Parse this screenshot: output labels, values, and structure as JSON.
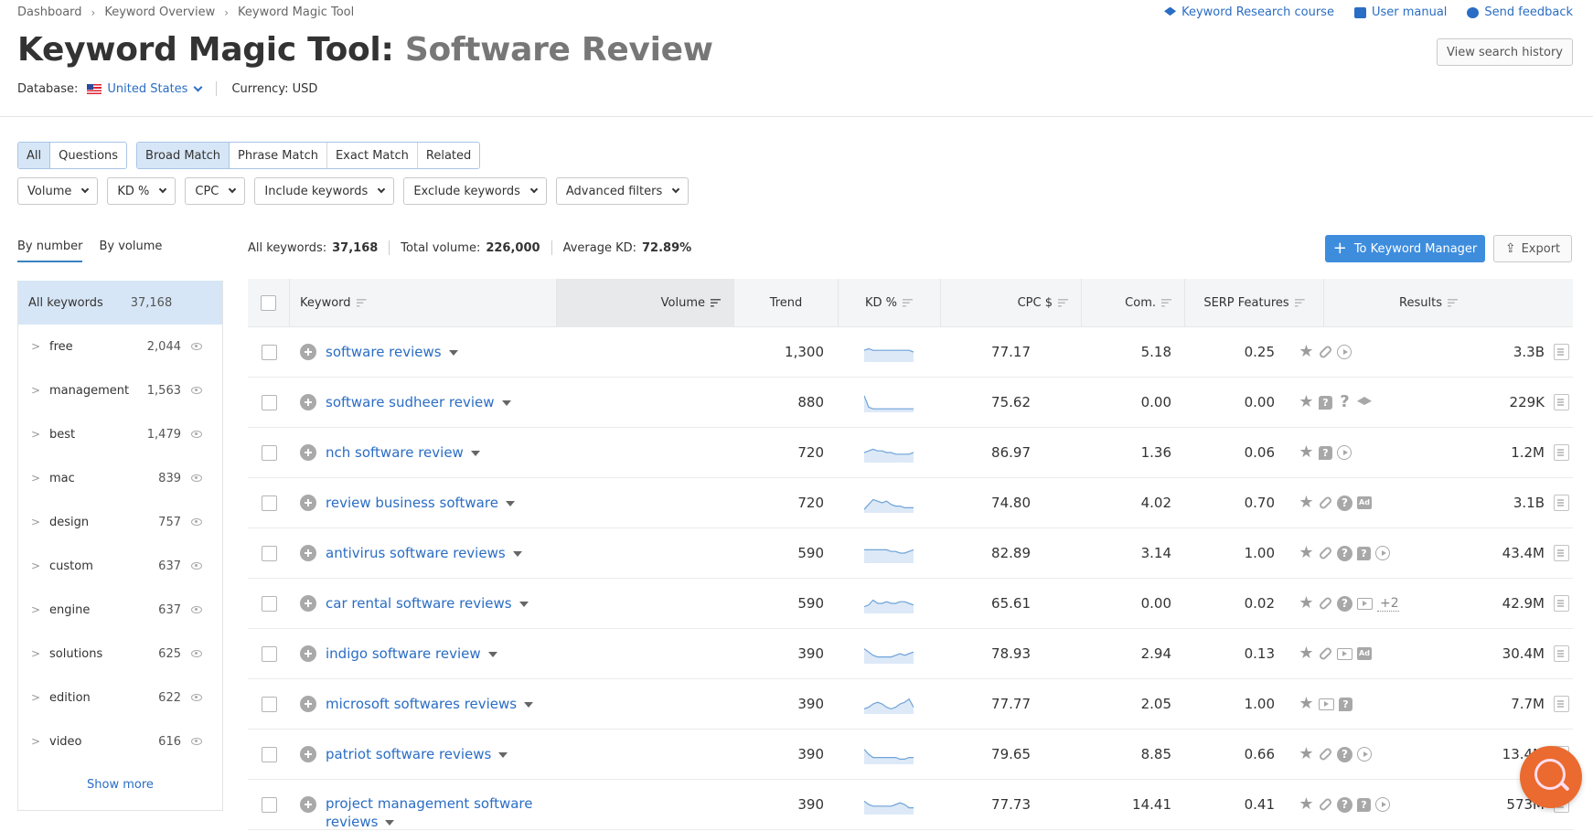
{
  "breadcrumb": [
    "Dashboard",
    "Keyword Overview",
    "Keyword Magic Tool"
  ],
  "header": {
    "title": "Keyword Magic Tool:",
    "subject": "Software Review",
    "database_label": "Database:",
    "database_value": "United States",
    "currency_label": "Currency: USD",
    "links": {
      "course": "Keyword Research course",
      "manual": "User manual",
      "feedback": "Send feedback"
    },
    "history_button": "View search history"
  },
  "tabs": {
    "group1": [
      {
        "label": "All",
        "active": true
      },
      {
        "label": "Questions",
        "active": false
      }
    ],
    "group2": [
      {
        "label": "Broad Match",
        "active": true
      },
      {
        "label": "Phrase Match",
        "active": false
      },
      {
        "label": "Exact Match",
        "active": false
      },
      {
        "label": "Related",
        "active": false
      }
    ]
  },
  "filters": [
    "Volume",
    "KD %",
    "CPC",
    "Include keywords",
    "Exclude keywords",
    "Advanced filters"
  ],
  "view_tabs": {
    "by_number": "By number",
    "by_volume": "By volume"
  },
  "stats": {
    "all_keywords_label": "All keywords:",
    "all_keywords": "37,168",
    "total_volume_label": "Total volume:",
    "total_volume": "226,000",
    "avg_kd_label": "Average KD:",
    "avg_kd": "72.89%"
  },
  "actions": {
    "keyword_manager": "To Keyword Manager",
    "export": "Export"
  },
  "sidebar": {
    "all_label": "All keywords",
    "all_count": "37,168",
    "items": [
      {
        "label": "free",
        "count": "2,044"
      },
      {
        "label": "management",
        "count": "1,563"
      },
      {
        "label": "best",
        "count": "1,479"
      },
      {
        "label": "mac",
        "count": "839"
      },
      {
        "label": "design",
        "count": "757"
      },
      {
        "label": "custom",
        "count": "637"
      },
      {
        "label": "engine",
        "count": "637"
      },
      {
        "label": "solutions",
        "count": "625"
      },
      {
        "label": "edition",
        "count": "622"
      },
      {
        "label": "video",
        "count": "616"
      }
    ],
    "show_more": "Show more"
  },
  "table": {
    "columns": {
      "keyword": "Keyword",
      "volume": "Volume",
      "trend": "Trend",
      "kd": "KD %",
      "cpc": "CPC $",
      "com": "Com.",
      "serp": "SERP Features",
      "results": "Results"
    },
    "rows": [
      {
        "keyword": "software reviews",
        "volume": "1,300",
        "trend": [
          6,
          7,
          6,
          6,
          6,
          6,
          6,
          6,
          6,
          6,
          6,
          5
        ],
        "kd": "77.17",
        "cpc": "5.18",
        "com": "0.25",
        "serp": [
          "star",
          "link",
          "play"
        ],
        "results": "3.3B"
      },
      {
        "keyword": "software sudheer review",
        "volume": "880",
        "trend": [
          9,
          2,
          1,
          1,
          1,
          1,
          1,
          1,
          1,
          1,
          1,
          1
        ],
        "kd": "75.62",
        "cpc": "0.00",
        "com": "0.00",
        "serp": [
          "star",
          "bubble-question",
          "question",
          "graduation-cap"
        ],
        "results": "229K"
      },
      {
        "keyword": "nch software review",
        "volume": "720",
        "trend": [
          5,
          6,
          7,
          6,
          6,
          5,
          5,
          4,
          4,
          4,
          4,
          5
        ],
        "kd": "86.97",
        "cpc": "1.36",
        "com": "0.06",
        "serp": [
          "star",
          "bubble-question",
          "play"
        ],
        "results": "1.2M"
      },
      {
        "keyword": "review business software",
        "volume": "720",
        "trend": [
          1,
          4,
          7,
          6,
          5,
          6,
          4,
          3,
          3,
          2,
          2,
          2
        ],
        "kd": "74.80",
        "cpc": "4.02",
        "com": "0.70",
        "serp": [
          "star",
          "link",
          "faq",
          "ad"
        ],
        "results": "3.1B"
      },
      {
        "keyword": "antivirus software reviews",
        "volume": "590",
        "trend": [
          7,
          7,
          7,
          7,
          7,
          7,
          6,
          6,
          5,
          5,
          6,
          7
        ],
        "kd": "82.89",
        "cpc": "3.14",
        "com": "1.00",
        "serp": [
          "star",
          "link",
          "faq",
          "bubble-question",
          "play"
        ],
        "results": "43.4M"
      },
      {
        "keyword": "car rental software reviews",
        "volume": "590",
        "trend": [
          3,
          4,
          7,
          5,
          5,
          6,
          5,
          5,
          6,
          6,
          5,
          4
        ],
        "kd": "65.61",
        "cpc": "0.00",
        "com": "0.02",
        "serp": [
          "star",
          "link",
          "faq",
          "video",
          "+2"
        ],
        "results": "42.9M"
      },
      {
        "keyword": "indigo software review",
        "volume": "390",
        "trend": [
          8,
          6,
          4,
          3,
          3,
          3,
          3,
          4,
          5,
          4,
          5,
          6
        ],
        "kd": "78.93",
        "cpc": "2.94",
        "com": "0.13",
        "serp": [
          "star",
          "link",
          "video",
          "ad"
        ],
        "results": "30.4M"
      },
      {
        "keyword": "microsoft softwares reviews",
        "volume": "390",
        "trend": [
          2,
          3,
          5,
          6,
          5,
          3,
          2,
          3,
          5,
          6,
          8,
          3
        ],
        "kd": "77.77",
        "cpc": "2.05",
        "com": "1.00",
        "serp": [
          "star",
          "video",
          "bubble-question"
        ],
        "results": "7.7M"
      },
      {
        "keyword": "patriot software reviews",
        "volume": "390",
        "trend": [
          8,
          5,
          3,
          3,
          3,
          3,
          3,
          3,
          2,
          2,
          3,
          3
        ],
        "kd": "79.65",
        "cpc": "8.85",
        "com": "0.66",
        "serp": [
          "star",
          "link",
          "faq",
          "play"
        ],
        "results": "13.4M"
      },
      {
        "keyword": "project management software reviews",
        "volume": "390",
        "trend": [
          7,
          5,
          4,
          4,
          4,
          4,
          4,
          5,
          6,
          5,
          3,
          3
        ],
        "kd": "77.73",
        "cpc": "14.41",
        "com": "0.41",
        "serp": [
          "star",
          "link",
          "faq",
          "bubble-question",
          "play"
        ],
        "results": "573M"
      }
    ]
  },
  "colors": {
    "accent": "#2a6dc4",
    "primary_button": "#3e8ddd",
    "active_tab": "#d7e6f6",
    "fab": "#ea6a2f"
  }
}
